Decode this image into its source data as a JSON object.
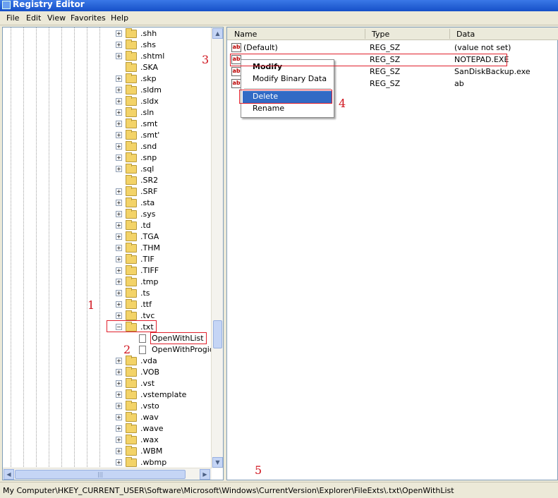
{
  "window": {
    "title": "Registry Editor"
  },
  "menu": [
    "File",
    "Edit",
    "View",
    "Favorites",
    "Help"
  ],
  "tree": {
    "items": [
      {
        "label": ".shh",
        "expandable": true
      },
      {
        "label": ".shs",
        "expandable": true
      },
      {
        "label": ".shtml",
        "expandable": true
      },
      {
        "label": ".SKA",
        "expandable": false
      },
      {
        "label": ".skp",
        "expandable": true
      },
      {
        "label": ".sldm",
        "expandable": true
      },
      {
        "label": ".sldx",
        "expandable": true
      },
      {
        "label": ".sln",
        "expandable": true
      },
      {
        "label": ".smt",
        "expandable": true
      },
      {
        "label": ".smt'",
        "expandable": true
      },
      {
        "label": ".snd",
        "expandable": true
      },
      {
        "label": ".snp",
        "expandable": true
      },
      {
        "label": ".sql",
        "expandable": true
      },
      {
        "label": ".SR2",
        "expandable": false
      },
      {
        "label": ".SRF",
        "expandable": true
      },
      {
        "label": ".sta",
        "expandable": true
      },
      {
        "label": ".sys",
        "expandable": true
      },
      {
        "label": ".td",
        "expandable": true
      },
      {
        "label": ".TGA",
        "expandable": true
      },
      {
        "label": ".THM",
        "expandable": true
      },
      {
        "label": ".TIF",
        "expandable": true
      },
      {
        "label": ".TIFF",
        "expandable": true
      },
      {
        "label": ".tmp",
        "expandable": true
      },
      {
        "label": ".ts",
        "expandable": true
      },
      {
        "label": ".ttf",
        "expandable": true
      },
      {
        "label": ".tvc",
        "expandable": true
      },
      {
        "label": ".txt",
        "expandable": true,
        "expanded": true
      },
      {
        "label": "OpenWithList",
        "child": true,
        "selected": true
      },
      {
        "label": "OpenWithProgids",
        "child": true
      },
      {
        "label": ".vda",
        "expandable": true
      },
      {
        "label": ".VOB",
        "expandable": true
      },
      {
        "label": ".vst",
        "expandable": true
      },
      {
        "label": ".vstemplate",
        "expandable": true
      },
      {
        "label": ".vsto",
        "expandable": true
      },
      {
        "label": ".wav",
        "expandable": true
      },
      {
        "label": ".wave",
        "expandable": true
      },
      {
        "label": ".wax",
        "expandable": true
      },
      {
        "label": ".WBM",
        "expandable": true
      },
      {
        "label": ".wbmp",
        "expandable": true
      }
    ]
  },
  "list": {
    "columns": [
      "Name",
      "Type",
      "Data"
    ],
    "rows": [
      {
        "name": "(Default)",
        "type": "REG_SZ",
        "data": "(value not set)"
      },
      {
        "name": "",
        "type": "REG_SZ",
        "data": "NOTEPAD.EXE"
      },
      {
        "name": "",
        "type": "REG_SZ",
        "data": "SanDiskBackup.exe"
      },
      {
        "name": "",
        "type": "REG_SZ",
        "data": "ab"
      }
    ]
  },
  "context_menu": {
    "items": [
      "Modify",
      "Modify Binary Data",
      "Delete",
      "Rename"
    ],
    "selected": "Delete"
  },
  "callouts": [
    "1",
    "2",
    "3",
    "4",
    "5"
  ],
  "status": {
    "path": "My Computer\\HKEY_CURRENT_USER\\Software\\Microsoft\\Windows\\CurrentVersion\\Explorer\\FileExts\\.txt\\OpenWithList"
  },
  "colors": {
    "annotation_red": "#e0202c",
    "selection_blue": "#316ac5",
    "title_blue": "#1650c8"
  }
}
